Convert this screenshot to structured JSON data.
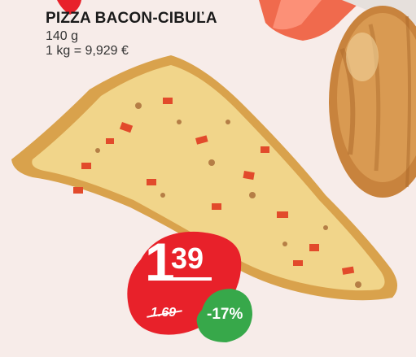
{
  "product": {
    "title": "PIZZA BACON-CIBUĽA",
    "weight": "140 g",
    "unit_price": "1 kg = 9,929 €"
  },
  "price": {
    "whole": "1",
    "cents": "39",
    "old_price": "1.69"
  },
  "discount": {
    "label": "-17%"
  },
  "colors": {
    "background": "#f7ece9",
    "price_red": "#e8212a",
    "discount_green": "#37a84a",
    "text_dark": "#1a1a1a"
  }
}
